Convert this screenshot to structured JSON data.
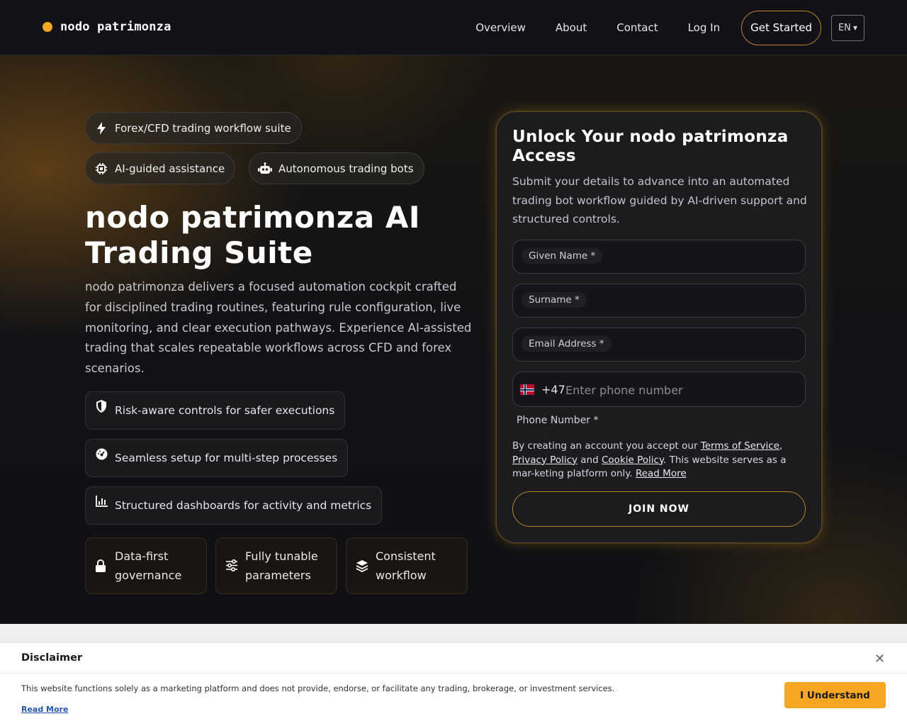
{
  "brand": {
    "name": "nodo patrimonza",
    "accent": "#f5a623"
  },
  "nav": {
    "links": [
      "Overview",
      "About",
      "Contact",
      "Log In"
    ],
    "cta": "Get Started",
    "language": "EN"
  },
  "hero": {
    "chips": [
      {
        "label": "Forex/CFD trading workflow suite",
        "icon": "lightning-icon"
      },
      {
        "label": "AI-guided assistance",
        "icon": "chip-icon"
      },
      {
        "label": "Autonomous trading bots",
        "icon": "robot-icon"
      }
    ],
    "title": "nodo patrimonza AI Trading Suite",
    "description": "nodo patrimonza delivers a focused automation cockpit crafted for disciplined trading routines, featuring rule configuration, live monitoring, and clear execution pathways. Experience AI-assisted trading that scales repeatable workflows across CFD and forex scenarios.",
    "features": [
      {
        "label": "Risk-aware controls for safer executions",
        "icon": "shield-icon"
      },
      {
        "label": "Seamless setup for multi-step processes",
        "icon": "gauge-icon"
      },
      {
        "label": "Structured dashboards for activity and metrics",
        "icon": "bar-chart-icon"
      }
    ],
    "tiles": [
      {
        "label": "Data-first governance",
        "icon": "lock-icon"
      },
      {
        "label": "Fully tunable parameters",
        "icon": "sliders-icon"
      },
      {
        "label": "Consistent workflow",
        "icon": "layers-icon"
      }
    ]
  },
  "form": {
    "title": "Unlock Your nodo patrimonza Access",
    "subtitle": "Submit your details to advance into an automated trading bot workflow guided by AI-driven support and structured controls.",
    "fields": {
      "given_name": "Given Name *",
      "surname": "Surname *",
      "email": "Email Address *"
    },
    "phone": {
      "country_icon": "norway-flag-icon",
      "dial_code": "+47",
      "placeholder": "Enter phone number",
      "label": "Phone Number *"
    },
    "terms": {
      "prefix": "By creating an account you accept our ",
      "terms_link": "Terms of Service",
      "comma": ",",
      "privacy_link": "Privacy Policy",
      "and": " and ",
      "cookie_link": "Cookie Policy",
      "suffix": ". This website serves as a mar-keting platform only. ",
      "read_more": "Read More"
    },
    "submit": "JOIN NOW"
  },
  "disclaimer": {
    "title": "Disclaimer",
    "close_icon": "close-icon",
    "text": "This website functions solely as a marketing platform and does not provide, endorse, or facilitate any trading, brokerage, or investment services.",
    "read_more": "Read More",
    "button": "I Understand"
  }
}
